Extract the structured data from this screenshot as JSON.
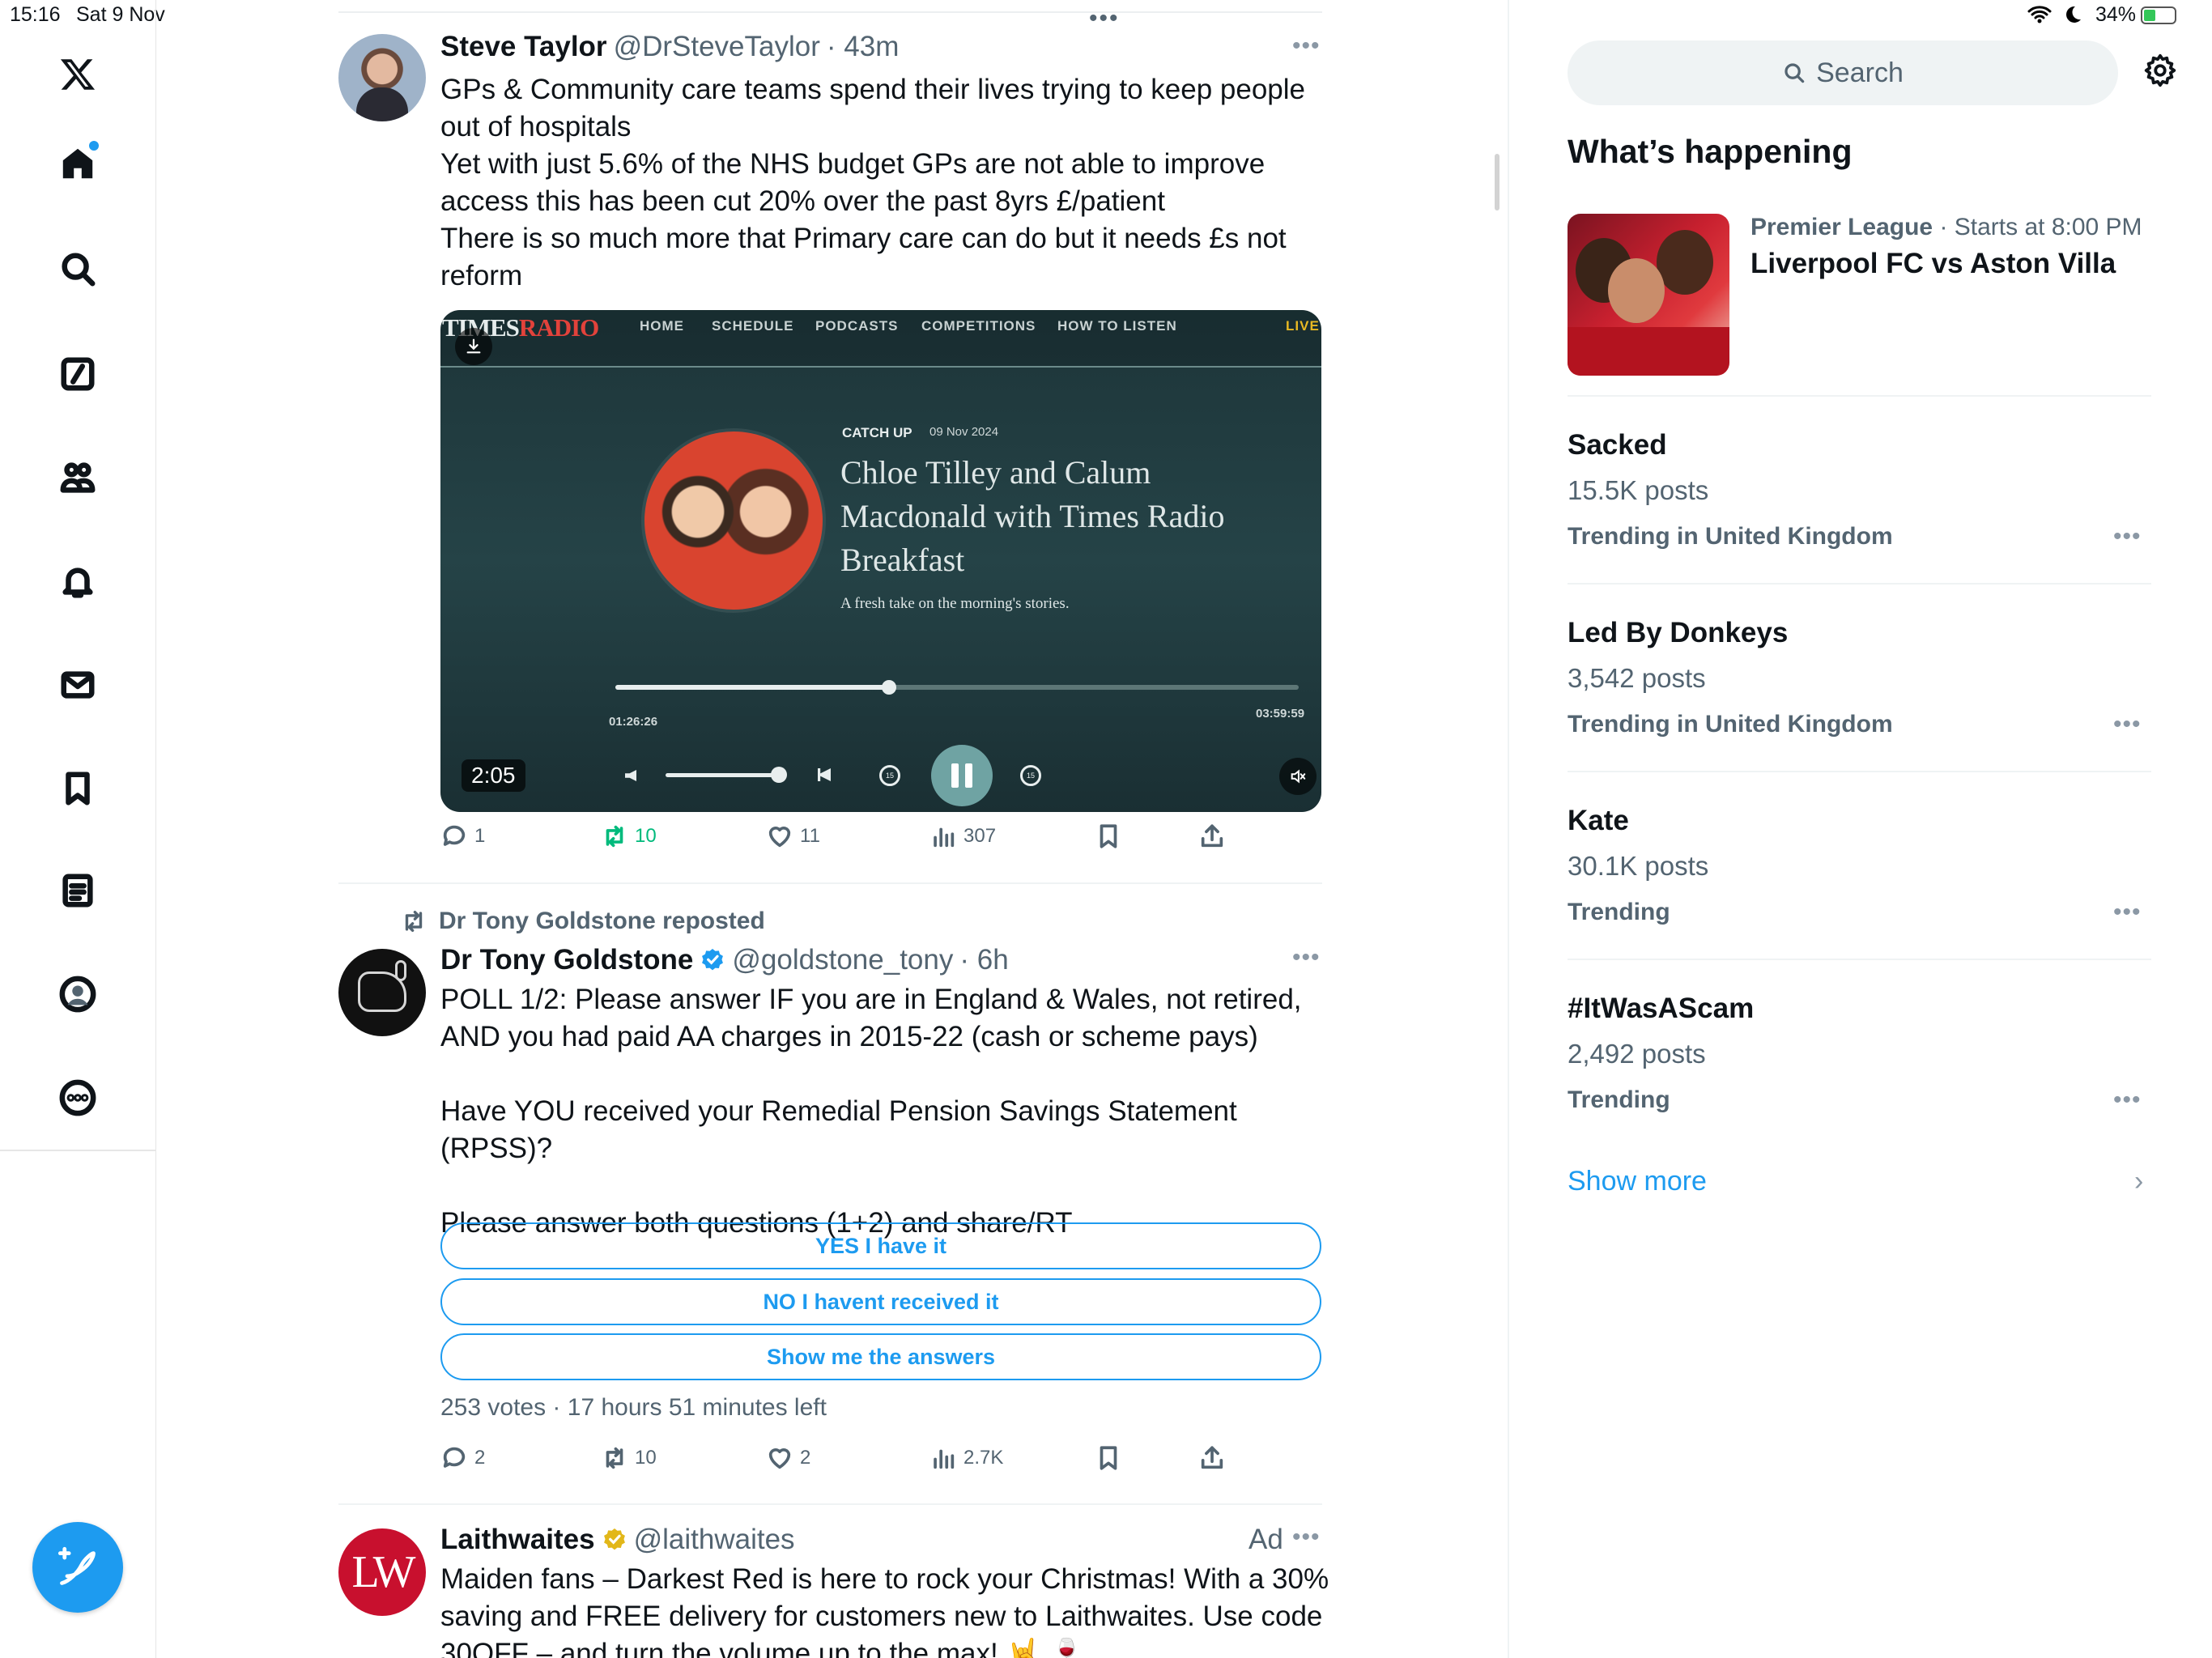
{
  "status_bar": {
    "time": "15:16",
    "date": "Sat 9 Nov",
    "battery": "34%"
  },
  "nav": {
    "items": [
      {
        "icon": "x-logo-icon"
      },
      {
        "icon": "home-icon"
      },
      {
        "icon": "search-icon"
      },
      {
        "icon": "grok-icon"
      },
      {
        "icon": "communities-icon"
      },
      {
        "icon": "bell-icon"
      },
      {
        "icon": "mail-icon"
      },
      {
        "icon": "bookmark-icon"
      },
      {
        "icon": "lists-icon"
      },
      {
        "icon": "profile-icon"
      },
      {
        "icon": "more-icon"
      }
    ],
    "compose_icon": "compose-icon"
  },
  "tweets": [
    {
      "name": "Steve Taylor",
      "handle": "@DrSteveTaylor",
      "time": "· 43m",
      "text": "GPs & Community care teams spend their lives trying to keep people\nout of hospitals\nYet with just 5.6% of the NHS budget GPs are not able to improve\naccess this has been cut 20% over the past 8yrs £/patient\nThere is so much more that Primary care can do but it needs £s not\nreform",
      "video": {
        "brand_times": "TIMES",
        "brand_radio": "RADIO",
        "nav": [
          "HOME",
          "SCHEDULE",
          "PODCASTS",
          "COMPETITIONS",
          "HOW TO LISTEN"
        ],
        "live": "LIVE",
        "catch_up": "CATCH UP",
        "date": "09 Nov 2024",
        "title": "Chloe Tilley and Calum\nMacdonald with Times Radio\nBreakfast",
        "subtitle": "A fresh take on the morning's stories.",
        "elapsed": "01:26:26",
        "total": "03:59:59",
        "duration_badge": "2:05",
        "progress": 0.4
      },
      "actions": {
        "replies": "1",
        "reposts": "10",
        "likes": "11",
        "views": "307"
      }
    },
    {
      "repost_label": "Dr Tony Goldstone reposted",
      "name": "Dr Tony Goldstone",
      "handle": "@goldstone_tony",
      "time": "· 6h",
      "text": "POLL 1/2: Please answer IF you are in England & Wales, not retired,\nAND you had paid AA charges in 2015-22 (cash or scheme pays)\n\nHave YOU received your Remedial Pension Savings Statement (RPSS)?\n\nPlease answer both questions (1+2) and share/RT",
      "poll": {
        "options": [
          "YES I have it",
          "NO I havent received it",
          "Show me the answers"
        ],
        "meta": "253 votes · 17 hours 51 minutes left"
      },
      "actions": {
        "replies": "2",
        "reposts": "10",
        "likes": "2",
        "views": "2.7K"
      }
    },
    {
      "name": "Laithwaites",
      "handle": "@laithwaites",
      "ad_label": "Ad",
      "avatar_text": "LW",
      "text": "Maiden fans – Darkest Red is here to rock your Christmas! With a 30%\nsaving and FREE delivery for customers new to Laithwaites. Use code\n30OFF – and turn the volume up to the max! 🤘 🍷"
    }
  ],
  "sidebar": {
    "search_placeholder": "Search",
    "section_title": "What’s happening",
    "featured": {
      "league": "Premier League",
      "time": "· Starts at 8:00 PM",
      "match": "Liverpool FC vs Aston Villa"
    },
    "trends": [
      {
        "title": "Sacked",
        "count": "15.5K posts",
        "context": "Trending in United Kingdom"
      },
      {
        "title": "Led By Donkeys",
        "count": "3,542 posts",
        "context": "Trending in United Kingdom"
      },
      {
        "title": "Kate",
        "count": "30.1K posts",
        "context": "Trending"
      },
      {
        "title": "#ItWasAScam",
        "count": "2,492 posts",
        "context": "Trending"
      }
    ],
    "show_more": "Show more"
  },
  "colors": {
    "accent": "#1d9bf0",
    "repost_green": "#00ba7c",
    "muted": "#536471"
  }
}
